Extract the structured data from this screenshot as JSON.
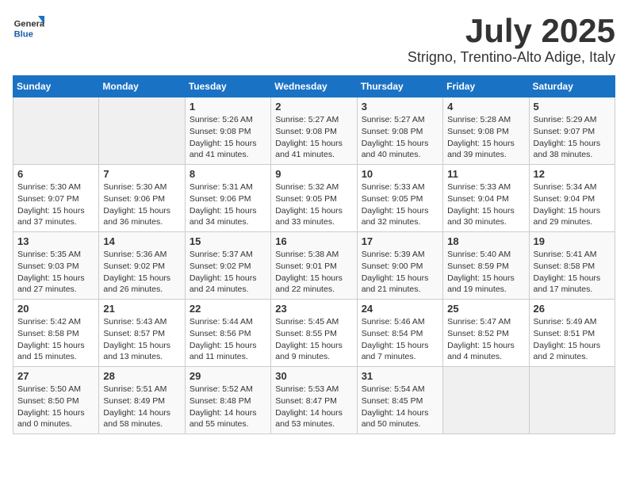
{
  "logo": {
    "text_general": "General",
    "text_blue": "Blue"
  },
  "title": "July 2025",
  "subtitle": "Strigno, Trentino-Alto Adige, Italy",
  "days_header": [
    "Sunday",
    "Monday",
    "Tuesday",
    "Wednesday",
    "Thursday",
    "Friday",
    "Saturday"
  ],
  "weeks": [
    [
      {
        "day": "",
        "info": ""
      },
      {
        "day": "",
        "info": ""
      },
      {
        "day": "1",
        "info": "Sunrise: 5:26 AM\nSunset: 9:08 PM\nDaylight: 15 hours\nand 41 minutes."
      },
      {
        "day": "2",
        "info": "Sunrise: 5:27 AM\nSunset: 9:08 PM\nDaylight: 15 hours\nand 41 minutes."
      },
      {
        "day": "3",
        "info": "Sunrise: 5:27 AM\nSunset: 9:08 PM\nDaylight: 15 hours\nand 40 minutes."
      },
      {
        "day": "4",
        "info": "Sunrise: 5:28 AM\nSunset: 9:08 PM\nDaylight: 15 hours\nand 39 minutes."
      },
      {
        "day": "5",
        "info": "Sunrise: 5:29 AM\nSunset: 9:07 PM\nDaylight: 15 hours\nand 38 minutes."
      }
    ],
    [
      {
        "day": "6",
        "info": "Sunrise: 5:30 AM\nSunset: 9:07 PM\nDaylight: 15 hours\nand 37 minutes."
      },
      {
        "day": "7",
        "info": "Sunrise: 5:30 AM\nSunset: 9:06 PM\nDaylight: 15 hours\nand 36 minutes."
      },
      {
        "day": "8",
        "info": "Sunrise: 5:31 AM\nSunset: 9:06 PM\nDaylight: 15 hours\nand 34 minutes."
      },
      {
        "day": "9",
        "info": "Sunrise: 5:32 AM\nSunset: 9:05 PM\nDaylight: 15 hours\nand 33 minutes."
      },
      {
        "day": "10",
        "info": "Sunrise: 5:33 AM\nSunset: 9:05 PM\nDaylight: 15 hours\nand 32 minutes."
      },
      {
        "day": "11",
        "info": "Sunrise: 5:33 AM\nSunset: 9:04 PM\nDaylight: 15 hours\nand 30 minutes."
      },
      {
        "day": "12",
        "info": "Sunrise: 5:34 AM\nSunset: 9:04 PM\nDaylight: 15 hours\nand 29 minutes."
      }
    ],
    [
      {
        "day": "13",
        "info": "Sunrise: 5:35 AM\nSunset: 9:03 PM\nDaylight: 15 hours\nand 27 minutes."
      },
      {
        "day": "14",
        "info": "Sunrise: 5:36 AM\nSunset: 9:02 PM\nDaylight: 15 hours\nand 26 minutes."
      },
      {
        "day": "15",
        "info": "Sunrise: 5:37 AM\nSunset: 9:02 PM\nDaylight: 15 hours\nand 24 minutes."
      },
      {
        "day": "16",
        "info": "Sunrise: 5:38 AM\nSunset: 9:01 PM\nDaylight: 15 hours\nand 22 minutes."
      },
      {
        "day": "17",
        "info": "Sunrise: 5:39 AM\nSunset: 9:00 PM\nDaylight: 15 hours\nand 21 minutes."
      },
      {
        "day": "18",
        "info": "Sunrise: 5:40 AM\nSunset: 8:59 PM\nDaylight: 15 hours\nand 19 minutes."
      },
      {
        "day": "19",
        "info": "Sunrise: 5:41 AM\nSunset: 8:58 PM\nDaylight: 15 hours\nand 17 minutes."
      }
    ],
    [
      {
        "day": "20",
        "info": "Sunrise: 5:42 AM\nSunset: 8:58 PM\nDaylight: 15 hours\nand 15 minutes."
      },
      {
        "day": "21",
        "info": "Sunrise: 5:43 AM\nSunset: 8:57 PM\nDaylight: 15 hours\nand 13 minutes."
      },
      {
        "day": "22",
        "info": "Sunrise: 5:44 AM\nSunset: 8:56 PM\nDaylight: 15 hours\nand 11 minutes."
      },
      {
        "day": "23",
        "info": "Sunrise: 5:45 AM\nSunset: 8:55 PM\nDaylight: 15 hours\nand 9 minutes."
      },
      {
        "day": "24",
        "info": "Sunrise: 5:46 AM\nSunset: 8:54 PM\nDaylight: 15 hours\nand 7 minutes."
      },
      {
        "day": "25",
        "info": "Sunrise: 5:47 AM\nSunset: 8:52 PM\nDaylight: 15 hours\nand 4 minutes."
      },
      {
        "day": "26",
        "info": "Sunrise: 5:49 AM\nSunset: 8:51 PM\nDaylight: 15 hours\nand 2 minutes."
      }
    ],
    [
      {
        "day": "27",
        "info": "Sunrise: 5:50 AM\nSunset: 8:50 PM\nDaylight: 15 hours\nand 0 minutes."
      },
      {
        "day": "28",
        "info": "Sunrise: 5:51 AM\nSunset: 8:49 PM\nDaylight: 14 hours\nand 58 minutes."
      },
      {
        "day": "29",
        "info": "Sunrise: 5:52 AM\nSunset: 8:48 PM\nDaylight: 14 hours\nand 55 minutes."
      },
      {
        "day": "30",
        "info": "Sunrise: 5:53 AM\nSunset: 8:47 PM\nDaylight: 14 hours\nand 53 minutes."
      },
      {
        "day": "31",
        "info": "Sunrise: 5:54 AM\nSunset: 8:45 PM\nDaylight: 14 hours\nand 50 minutes."
      },
      {
        "day": "",
        "info": ""
      },
      {
        "day": "",
        "info": ""
      }
    ]
  ]
}
